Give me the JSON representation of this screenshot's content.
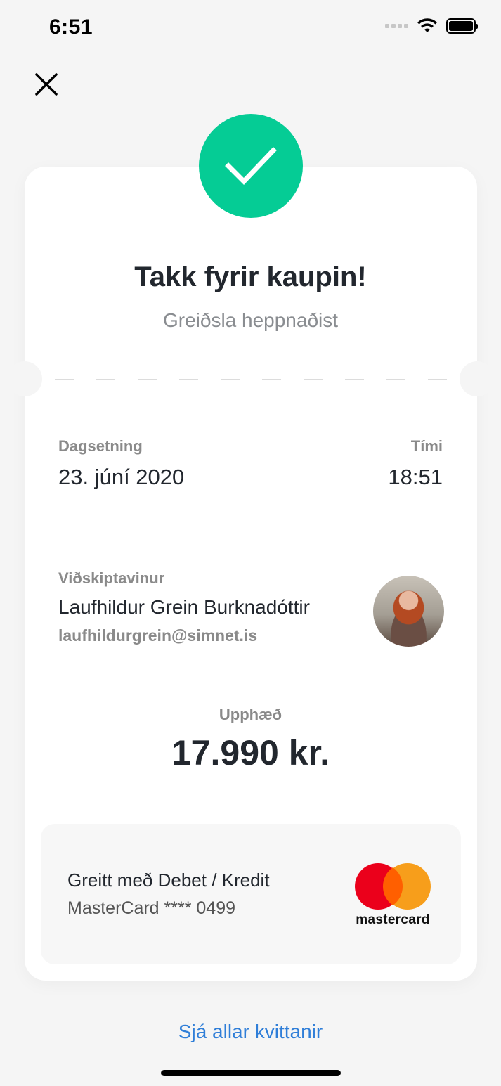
{
  "status_bar": {
    "time": "6:51"
  },
  "header": {
    "close_icon": "close-icon"
  },
  "success": {
    "icon": "checkmark-icon",
    "title": "Takk fyrir kaupin!",
    "subtitle": "Greiðsla heppnaðist"
  },
  "details": {
    "date_label": "Dagsetning",
    "date_value": "23. júní 2020",
    "time_label": "Tími",
    "time_value": "18:51"
  },
  "customer": {
    "label": "Viðskiptavinur",
    "name": "Laufhildur Grein Burknadóttir",
    "email": "laufhildurgrein@simnet.is"
  },
  "amount": {
    "label": "Upphæð",
    "value": "17.990 kr."
  },
  "payment": {
    "title": "Greitt með Debet / Kredit",
    "card": "MasterCard **** 0499",
    "brand_logo": "mastercard"
  },
  "footer": {
    "link": "Sjá allar kvittanir"
  },
  "colors": {
    "success": "#05cc95",
    "link": "#2f7ed8",
    "mc_red": "#eb001b",
    "mc_orange": "#f79e1b"
  }
}
